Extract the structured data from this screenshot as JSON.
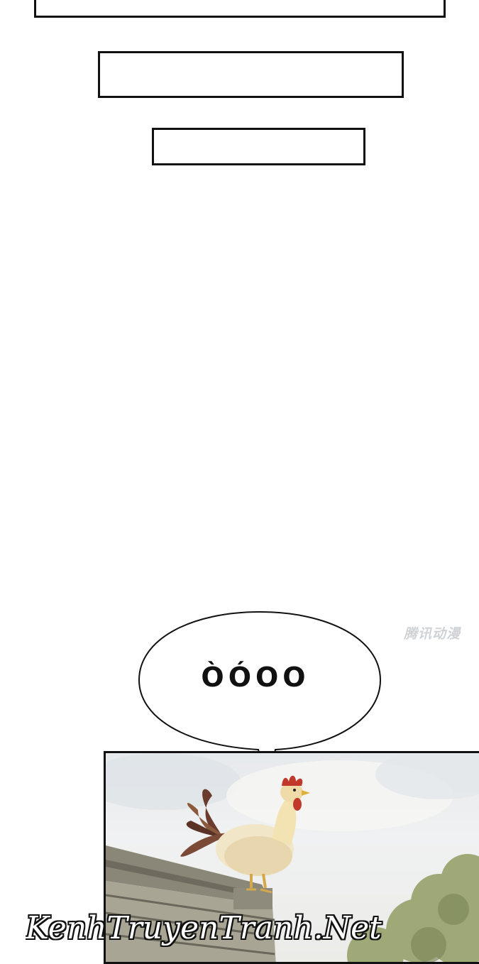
{
  "caption_boxes": [
    {
      "text": ""
    },
    {
      "text": ""
    },
    {
      "text": ""
    }
  ],
  "publisher_watermark": "腾讯动漫",
  "speech_bubble": {
    "text": "ÒÓOO"
  },
  "panel": {
    "scene": "rooster-on-rooftop"
  },
  "site_watermark": "KenhTruyenTranh.Net"
}
